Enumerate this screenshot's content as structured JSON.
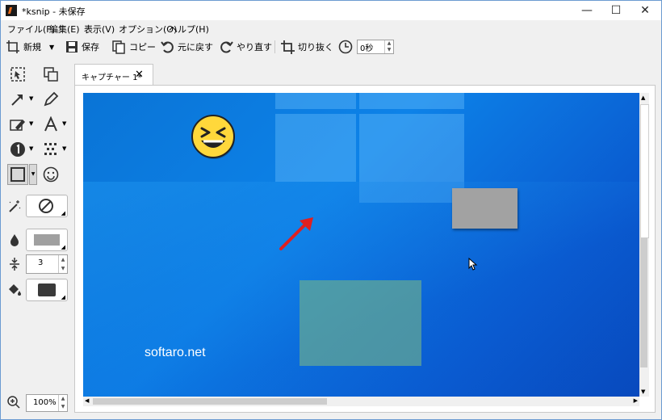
{
  "window": {
    "title": "*ksnip - 未保存"
  },
  "menu": [
    "ファイル(F)",
    "編集(E)",
    "表示(V)",
    "オプション(O)",
    "ヘルプ(H)"
  ],
  "toolbar": {
    "new_label": "新規",
    "save_label": "保存",
    "copy_label": "コピー",
    "undo_label": "元に戻す",
    "redo_label": "やり直す",
    "crop_label": "切り抜く",
    "delay_value": "0秒"
  },
  "left": {
    "number_size": "3",
    "zoom_value": "100%"
  },
  "tab": {
    "label": "キャプチャー 1*"
  },
  "canvas": {
    "watermark_text": "softaro.net"
  }
}
